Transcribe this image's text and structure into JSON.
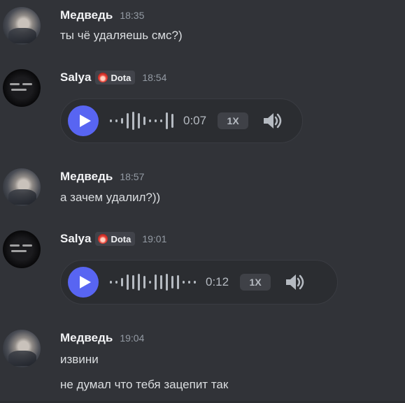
{
  "messages": [
    {
      "author": "Медведь",
      "time": "18:35",
      "lines": [
        "ты чё удаляешь смс?)"
      ]
    },
    {
      "author": "Salya",
      "tag": "Dota",
      "time": "18:54",
      "voice": {
        "duration": "0:07",
        "speed": "1X"
      }
    },
    {
      "author": "Медведь",
      "time": "18:57",
      "lines": [
        "а зачем удалил?))"
      ]
    },
    {
      "author": "Salya",
      "tag": "Dota",
      "time": "19:01",
      "voice": {
        "duration": "0:12",
        "speed": "1X"
      }
    },
    {
      "author": "Медведь",
      "time": "19:04",
      "lines": [
        "извини",
        "не думал что тебя зацепит так"
      ]
    }
  ],
  "icons": {
    "play": "play-icon",
    "volume": "speaker-icon",
    "tag": "flame-icon"
  },
  "colors": {
    "background": "#313338",
    "accent": "#5865f2",
    "voice_bg": "#2b2d31"
  }
}
